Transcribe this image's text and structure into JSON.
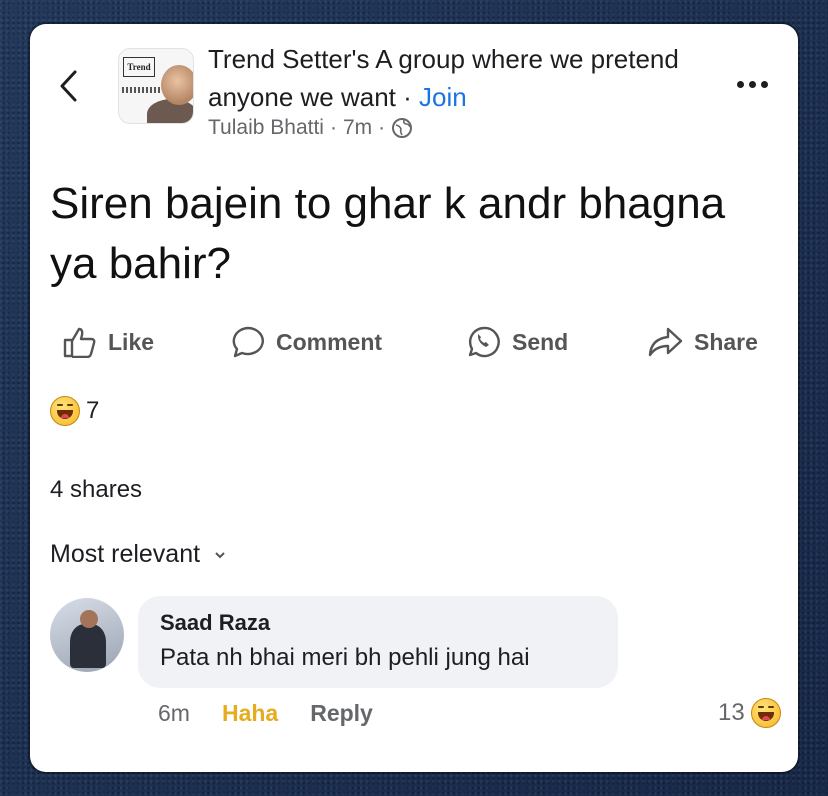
{
  "header": {
    "group_title": "Trend Setter's A group where we pretend anyone we want",
    "separator": "·",
    "join_label": "Join",
    "author": "Tulaib Bhatti",
    "time": "7m",
    "dot": "·",
    "privacy_icon": "globe-icon",
    "logo_text": "Trend",
    "back_icon": "chevron-left-icon",
    "more_icon": "more-horizontal-icon"
  },
  "post": {
    "text": "Siren bajein to ghar k andr bhagna ya bahir?"
  },
  "actions": {
    "like": "Like",
    "comment": "Comment",
    "send": "Send",
    "share": "Share"
  },
  "stats": {
    "reaction_icon": "haha-emoji-icon",
    "reaction_count": "7",
    "shares": "4 shares"
  },
  "comments": {
    "sort_label": "Most relevant",
    "items": [
      {
        "name": "Saad Raza",
        "text": "Pata nh bhai meri bh pehli jung hai",
        "time": "6m",
        "reaction_label": "Haha",
        "reply_label": "Reply",
        "reaction_count": "13"
      }
    ]
  },
  "colors": {
    "accent": "#1b74e4",
    "haha": "#e6ac1e",
    "muted": "#65676b",
    "bubble": "#f0f2f5"
  }
}
